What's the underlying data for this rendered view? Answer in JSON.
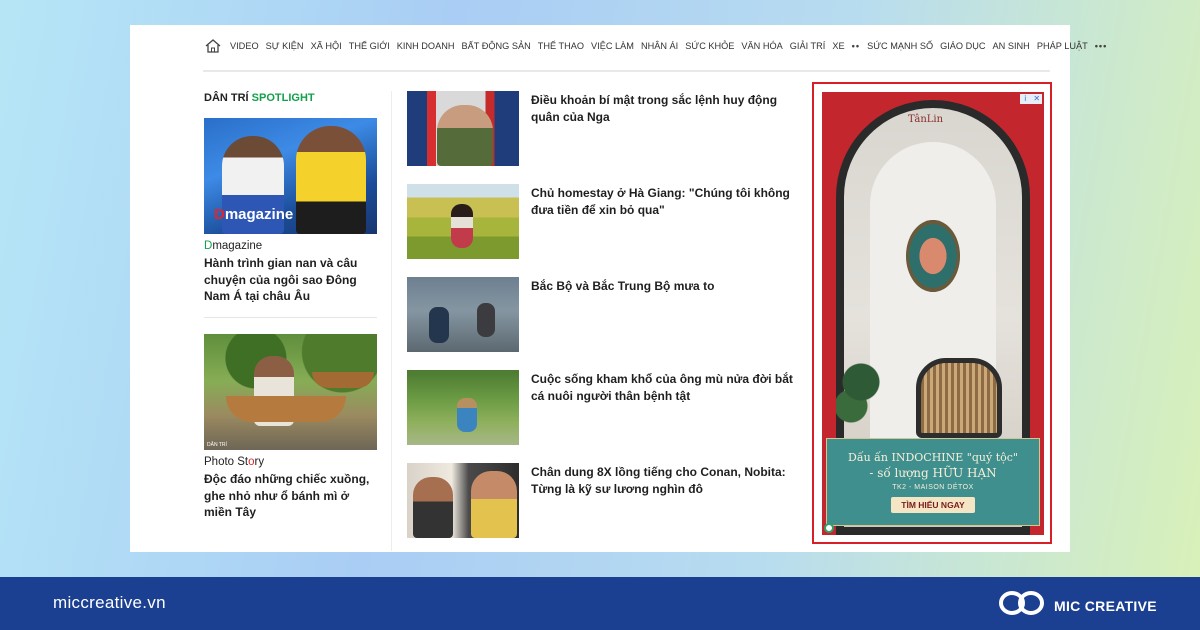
{
  "nav": {
    "items": [
      "VIDEO",
      "SỰ KIỆN",
      "XÃ HỘI",
      "THẾ GIỚI",
      "KINH DOANH",
      "BẤT ĐỘNG SẢN",
      "THỂ THAO",
      "VIỆC LÀM",
      "NHÂN ÁI",
      "SỨC KHỎE",
      "VĂN HÓA",
      "GIẢI TRÍ",
      "XE",
      "••",
      "SỨC MẠNH SỐ",
      "GIÁO DỤC",
      "AN SINH",
      "PHÁP LUẬT",
      "•••"
    ]
  },
  "spotlight": {
    "prefix": "DÂN TRÍ",
    "highlight": "SPOTLIGHT",
    "features": [
      {
        "image_text_mark": "D",
        "image_text_rest": "magazine",
        "label_prefix": "D",
        "label_rest": "magazine",
        "title": "Hành trình gian nan và câu chuyện của ngôi sao Đông Nam Á tại châu Âu"
      },
      {
        "watermark": "DÂN TRÍ",
        "label_prefix": "Photo St",
        "label_red": "o",
        "label_rest": "ry",
        "title": "Độc đáo những chiếc xuồng, ghe nhỏ như ổ bánh mì ở miền Tây"
      }
    ]
  },
  "articles": [
    {
      "title": "Điều khoản bí mật trong sắc lệnh huy động quân của Nga"
    },
    {
      "title": "Chủ homestay ở Hà Giang: \"Chúng tôi không đưa tiền để xin bỏ qua\""
    },
    {
      "title": "Bắc Bộ và Bắc Trung Bộ mưa to"
    },
    {
      "title": "Cuộc sống kham khổ của ông mù nửa đời bắt cá nuôi người thân bệnh tật"
    },
    {
      "title": "Chân dung 8X lồng tiếng cho Conan, Nobita: Từng là kỹ sư lương nghìn đô"
    }
  ],
  "ad": {
    "logo": "TânLin",
    "line1": "Dấu ấn INDOCHINE \"quý tộc\"",
    "line2": "- số lượng HỮU HẠN",
    "line3": "TK2 - MAISON DÉTOX",
    "button": "TÌM HIỂU NGAY",
    "controls": [
      "i",
      "✕"
    ],
    "highlight_color": "#d91f26"
  },
  "footer": {
    "site": "miccreative.vn",
    "brand": "MIC CREATIVE"
  }
}
